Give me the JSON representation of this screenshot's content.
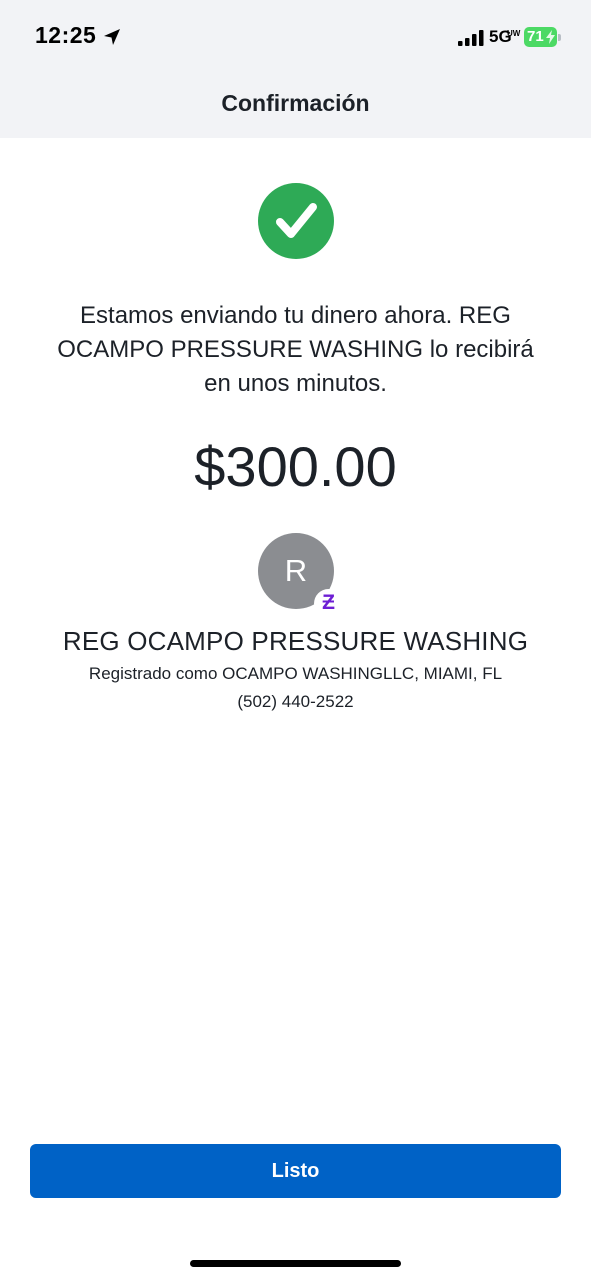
{
  "status_bar": {
    "time": "12:25",
    "network": "5G",
    "network_sub": "UW",
    "battery": "71",
    "icons": [
      "location-arrow-icon",
      "cellular-signal-icon",
      "battery-charging-icon"
    ]
  },
  "header": {
    "title": "Confirmación"
  },
  "confirmation": {
    "icon": "checkmark-circle-icon",
    "message": "Estamos enviando tu dinero ahora. REG OCAMPO PRESSURE WASHING lo recibirá en unos minutos.",
    "amount": "$300.00"
  },
  "recipient": {
    "avatar_initial": "R",
    "badge_glyph": "Ƶ",
    "badge_icon": "zelle-icon",
    "name": "REG OCAMPO PRESSURE WASHING",
    "registered_as": "Registrado como OCAMPO WASHINGLLC, MIAMI, FL",
    "phone": "(502) 440-2522"
  },
  "actions": {
    "done_label": "Listo"
  },
  "colors": {
    "success": "#2eaa56",
    "primary_button": "#0062c6",
    "avatar": "#8b8d91",
    "zelle_purple": "#6d1ed4",
    "battery": "#4cd964",
    "header_background": "#f2f3f6"
  }
}
